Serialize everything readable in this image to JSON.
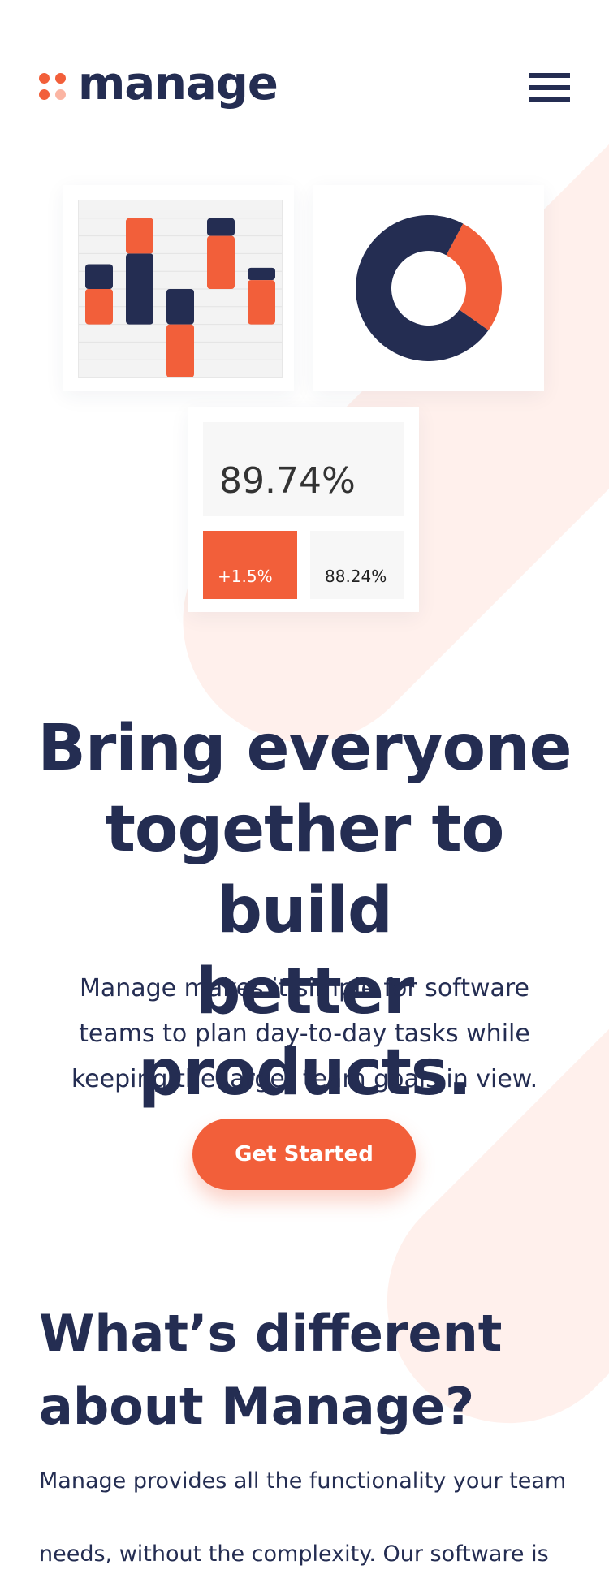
{
  "brand": {
    "name": "manage",
    "accent_color": "#f25f3a",
    "accent_light": "#fbb5a3",
    "dark_color": "#242d52",
    "background_tint": "#fff0ec"
  },
  "header": {
    "menu_icon": "hamburger-menu-icon"
  },
  "illustration": {
    "bar_chart": {
      "type": "floating-bar",
      "colors": [
        "#f25f3a",
        "#242d52"
      ],
      "bars": [
        {
          "orange": [
            0.3,
            0.5
          ],
          "navy": [
            0.5,
            0.64
          ]
        },
        {
          "orange": [
            0.7,
            0.9
          ],
          "navy": [
            0.3,
            0.7
          ]
        },
        {
          "orange": [
            0.0,
            0.3
          ],
          "navy": [
            0.3,
            0.5
          ]
        },
        {
          "orange": [
            0.5,
            0.8
          ],
          "navy": [
            0.8,
            0.9
          ]
        },
        {
          "orange": [
            0.3,
            0.55
          ],
          "navy": [
            0.55,
            0.62
          ]
        }
      ]
    },
    "donut_chart": {
      "type": "donut",
      "segments": [
        {
          "value": 27,
          "color": "#f25f3a"
        },
        {
          "value": 73,
          "color": "#242d52"
        }
      ]
    },
    "stats": {
      "main_value": "89.74%",
      "change_value": "+1.5%",
      "secondary_value": "88.24%"
    }
  },
  "hero": {
    "title_lines": [
      "Bring everyone",
      "together to build",
      "better products."
    ],
    "description_lines": [
      "Manage makes it simple for software",
      "teams to plan day-to-day tasks while",
      "keeping the larger team goals in view."
    ],
    "cta_label": "Get Started"
  },
  "section": {
    "title_lines": [
      "What’s different",
      "about Manage?"
    ],
    "description_lines": [
      "Manage provides all the functionality your team",
      "needs, without the complexity. Our software is"
    ]
  }
}
